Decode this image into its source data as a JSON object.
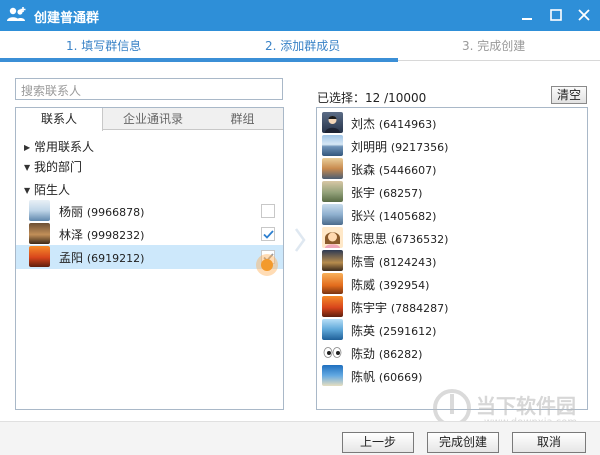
{
  "window": {
    "title": "创建普通群"
  },
  "steps": [
    "1. 填写群信息",
    "2. 添加群成员",
    "3. 完成创建"
  ],
  "search": {
    "placeholder": "搜索联系人"
  },
  "tabs": [
    "联系人",
    "企业通讯录",
    "群组"
  ],
  "groups": [
    {
      "label": "常用联系人",
      "expanded": false
    },
    {
      "label": "我的部门",
      "expanded": true
    },
    {
      "label": "陌生人",
      "expanded": true
    }
  ],
  "contacts": [
    {
      "name": "杨丽",
      "id": "(9966878)",
      "checked": false,
      "avatar": "snow-icon"
    },
    {
      "name": "林泽",
      "id": "(9998232)",
      "checked": true,
      "avatar": "wood-icon"
    },
    {
      "name": "孟阳",
      "id": "(6919212)",
      "checked": true,
      "avatar": "sunset-icon",
      "selected": true
    }
  ],
  "selected_count": {
    "label": "已选择：",
    "value": "12 /10000"
  },
  "clear_label": "清空",
  "members": [
    {
      "name": "刘杰",
      "id": "(6414963)",
      "avatar": "face"
    },
    {
      "name": "刘明明",
      "id": "(9217356)",
      "avatar": "sea"
    },
    {
      "name": "张森",
      "id": "(5446607)",
      "avatar": "dusk"
    },
    {
      "name": "张宇",
      "id": "(68257)",
      "avatar": "field"
    },
    {
      "name": "张兴",
      "id": "(1405682)",
      "avatar": "road"
    },
    {
      "name": "陈思思",
      "id": "(6736532)",
      "avatar": "girl"
    },
    {
      "name": "陈雪",
      "id": "(8124243)",
      "avatar": "night"
    },
    {
      "name": "陈威",
      "id": "(392954)",
      "avatar": "mars"
    },
    {
      "name": "陈宇宇",
      "id": "(7884287)",
      "avatar": "sunset"
    },
    {
      "name": "陈英",
      "id": "(2591612)",
      "avatar": "ocean"
    },
    {
      "name": "陈劲",
      "id": "(86282)",
      "avatar": "eyes"
    },
    {
      "name": "陈帆",
      "id": "(60669)",
      "avatar": "beach"
    }
  ],
  "buttons": {
    "prev": "上一步",
    "finish": "完成创建",
    "cancel": "取消"
  },
  "watermark": {
    "text": "当下软件园",
    "url": "www.downxia.com"
  },
  "colors": {
    "titlebar": "#2e8fd8",
    "accent": "#3a83c7",
    "selection": "#cde8fb"
  }
}
